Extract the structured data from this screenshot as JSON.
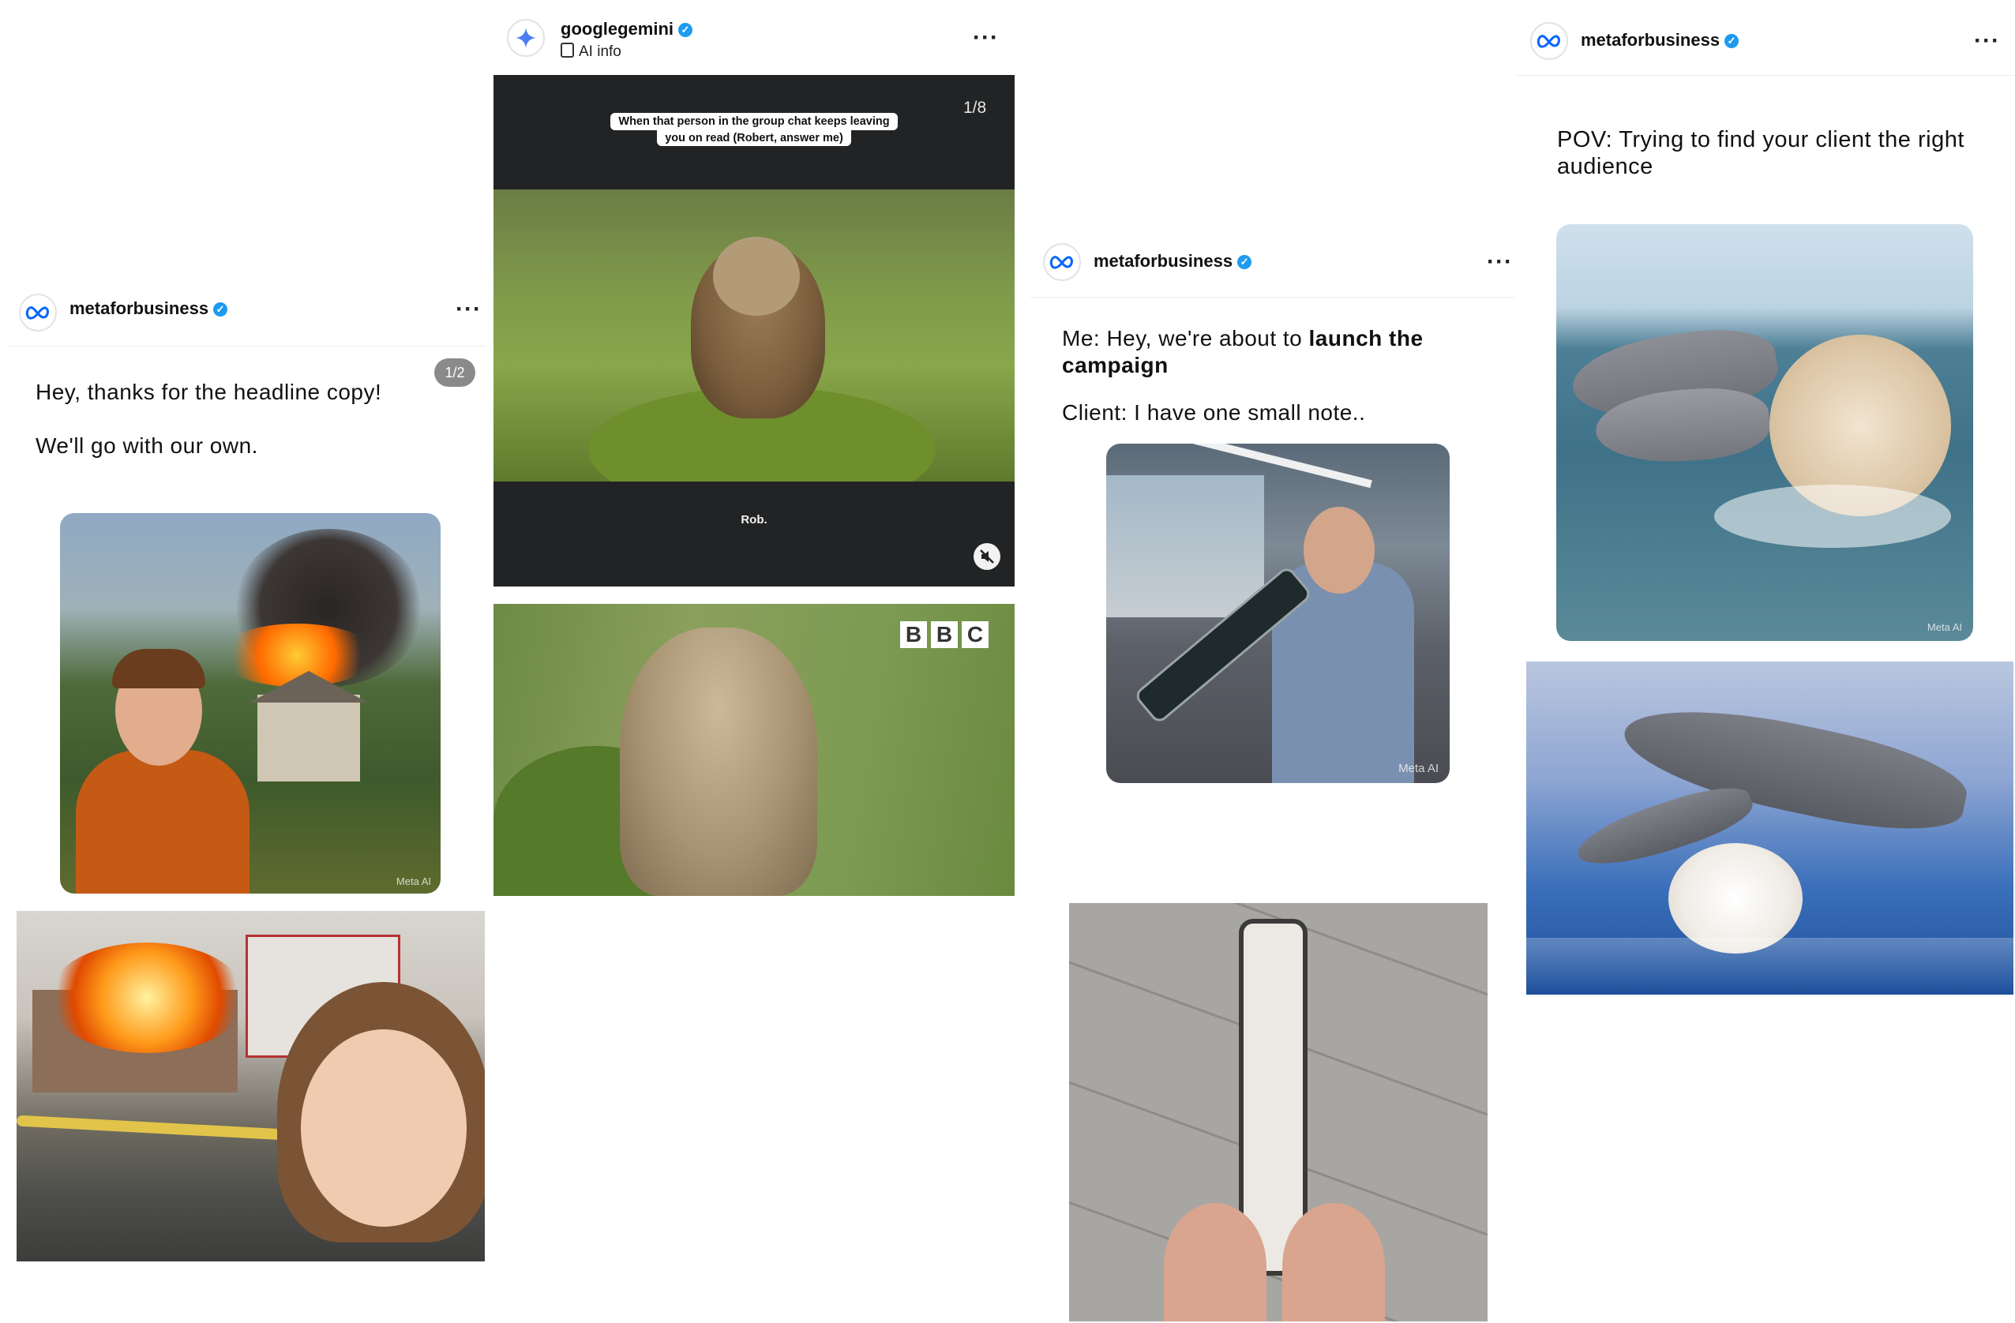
{
  "posts": [
    {
      "username": "metaforbusiness",
      "counter": "1/2",
      "line1": "Hey, thanks for the headline copy!",
      "line2": "We'll go with our own.",
      "watermark": "Meta AI"
    },
    {
      "username": "googlegemini",
      "ai_info": "AI info",
      "counter": "1/8",
      "caption_line1": "When that person in the group chat keeps leaving",
      "caption_line2": "you on read (Robert, answer me)",
      "subtitle": "Rob.",
      "bbc_logo": [
        "B",
        "B",
        "C"
      ]
    },
    {
      "username": "metaforbusiness",
      "line1_prefix": "Me: Hey, we're about to ",
      "line1_bold": "launch the campaign",
      "line2": "Client: I have one small note..",
      "watermark": "Meta AI"
    },
    {
      "username": "metaforbusiness",
      "text": "POV: Trying to find your client the right audience",
      "watermark": "Meta AI"
    }
  ],
  "icons": {
    "meta_logo": "meta-infinity-logo",
    "gemini_logo": "gemini-sparkle-logo",
    "verified": "verified-badge",
    "more": "ellipsis",
    "mute": "speaker-muted"
  },
  "colors": {
    "verified_blue": "#1d9bf0",
    "meta_blue": "#0866ff",
    "dark_panel": "#222324"
  }
}
